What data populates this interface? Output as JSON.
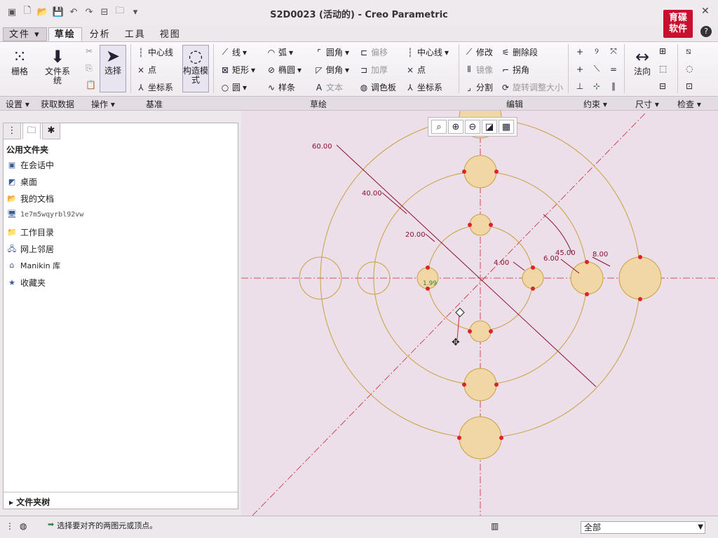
{
  "window": {
    "title": "S2D0023 (活动的) - Creo Parametric",
    "logo_text": "育碟软件"
  },
  "menu_tabs": [
    "文件",
    "草绘",
    "分析",
    "工具",
    "视图"
  ],
  "ribbon": {
    "settings": {
      "grid": "栅格"
    },
    "get_data": {
      "file_system": "文件系统"
    },
    "operations": {
      "select": "选择"
    },
    "datum": {
      "centerline": "中心线",
      "point": "点",
      "coord_sys": "坐标系"
    },
    "construct": {
      "label": "构造模式"
    },
    "sketch": {
      "line": "线",
      "rectangle": "矩形",
      "circle": "圆",
      "arc": "弧",
      "ellipse": "椭圆",
      "spline": "样条",
      "fillet": "圆角",
      "chamfer": "倒角",
      "text": "文本",
      "offset": "偏移",
      "thicken": "加厚",
      "palette": "调色板",
      "centerline": "中心线",
      "point": "点",
      "coord_sys": "坐标系"
    },
    "edit": {
      "modify": "修改",
      "mirror": "镜像",
      "divide": "分割",
      "delete_segment": "删除段",
      "corner": "拐角",
      "rotate_resize": "旋转调整大小"
    },
    "dimension": {
      "normal": "法向"
    }
  },
  "groups": [
    "设置",
    "获取数据",
    "操作",
    "基准",
    "草绘",
    "编辑",
    "约束",
    "尺寸",
    "检查"
  ],
  "panel": {
    "heading": "公用文件夹",
    "items": [
      "在会话中",
      "桌面",
      "我的文档",
      "1e7m5wqyrbl92vw",
      "工作目录",
      "网上邻居",
      "Manikin 库",
      "收藏夹"
    ],
    "tree": "文件夹树"
  },
  "dims": [
    "60.00",
    "40.00",
    "20.00",
    "4.00",
    "6.00",
    "45.00",
    "8.00",
    "1.99"
  ],
  "status": {
    "message": "选择要对齐的两图元或顶点。",
    "filter": "全部"
  }
}
